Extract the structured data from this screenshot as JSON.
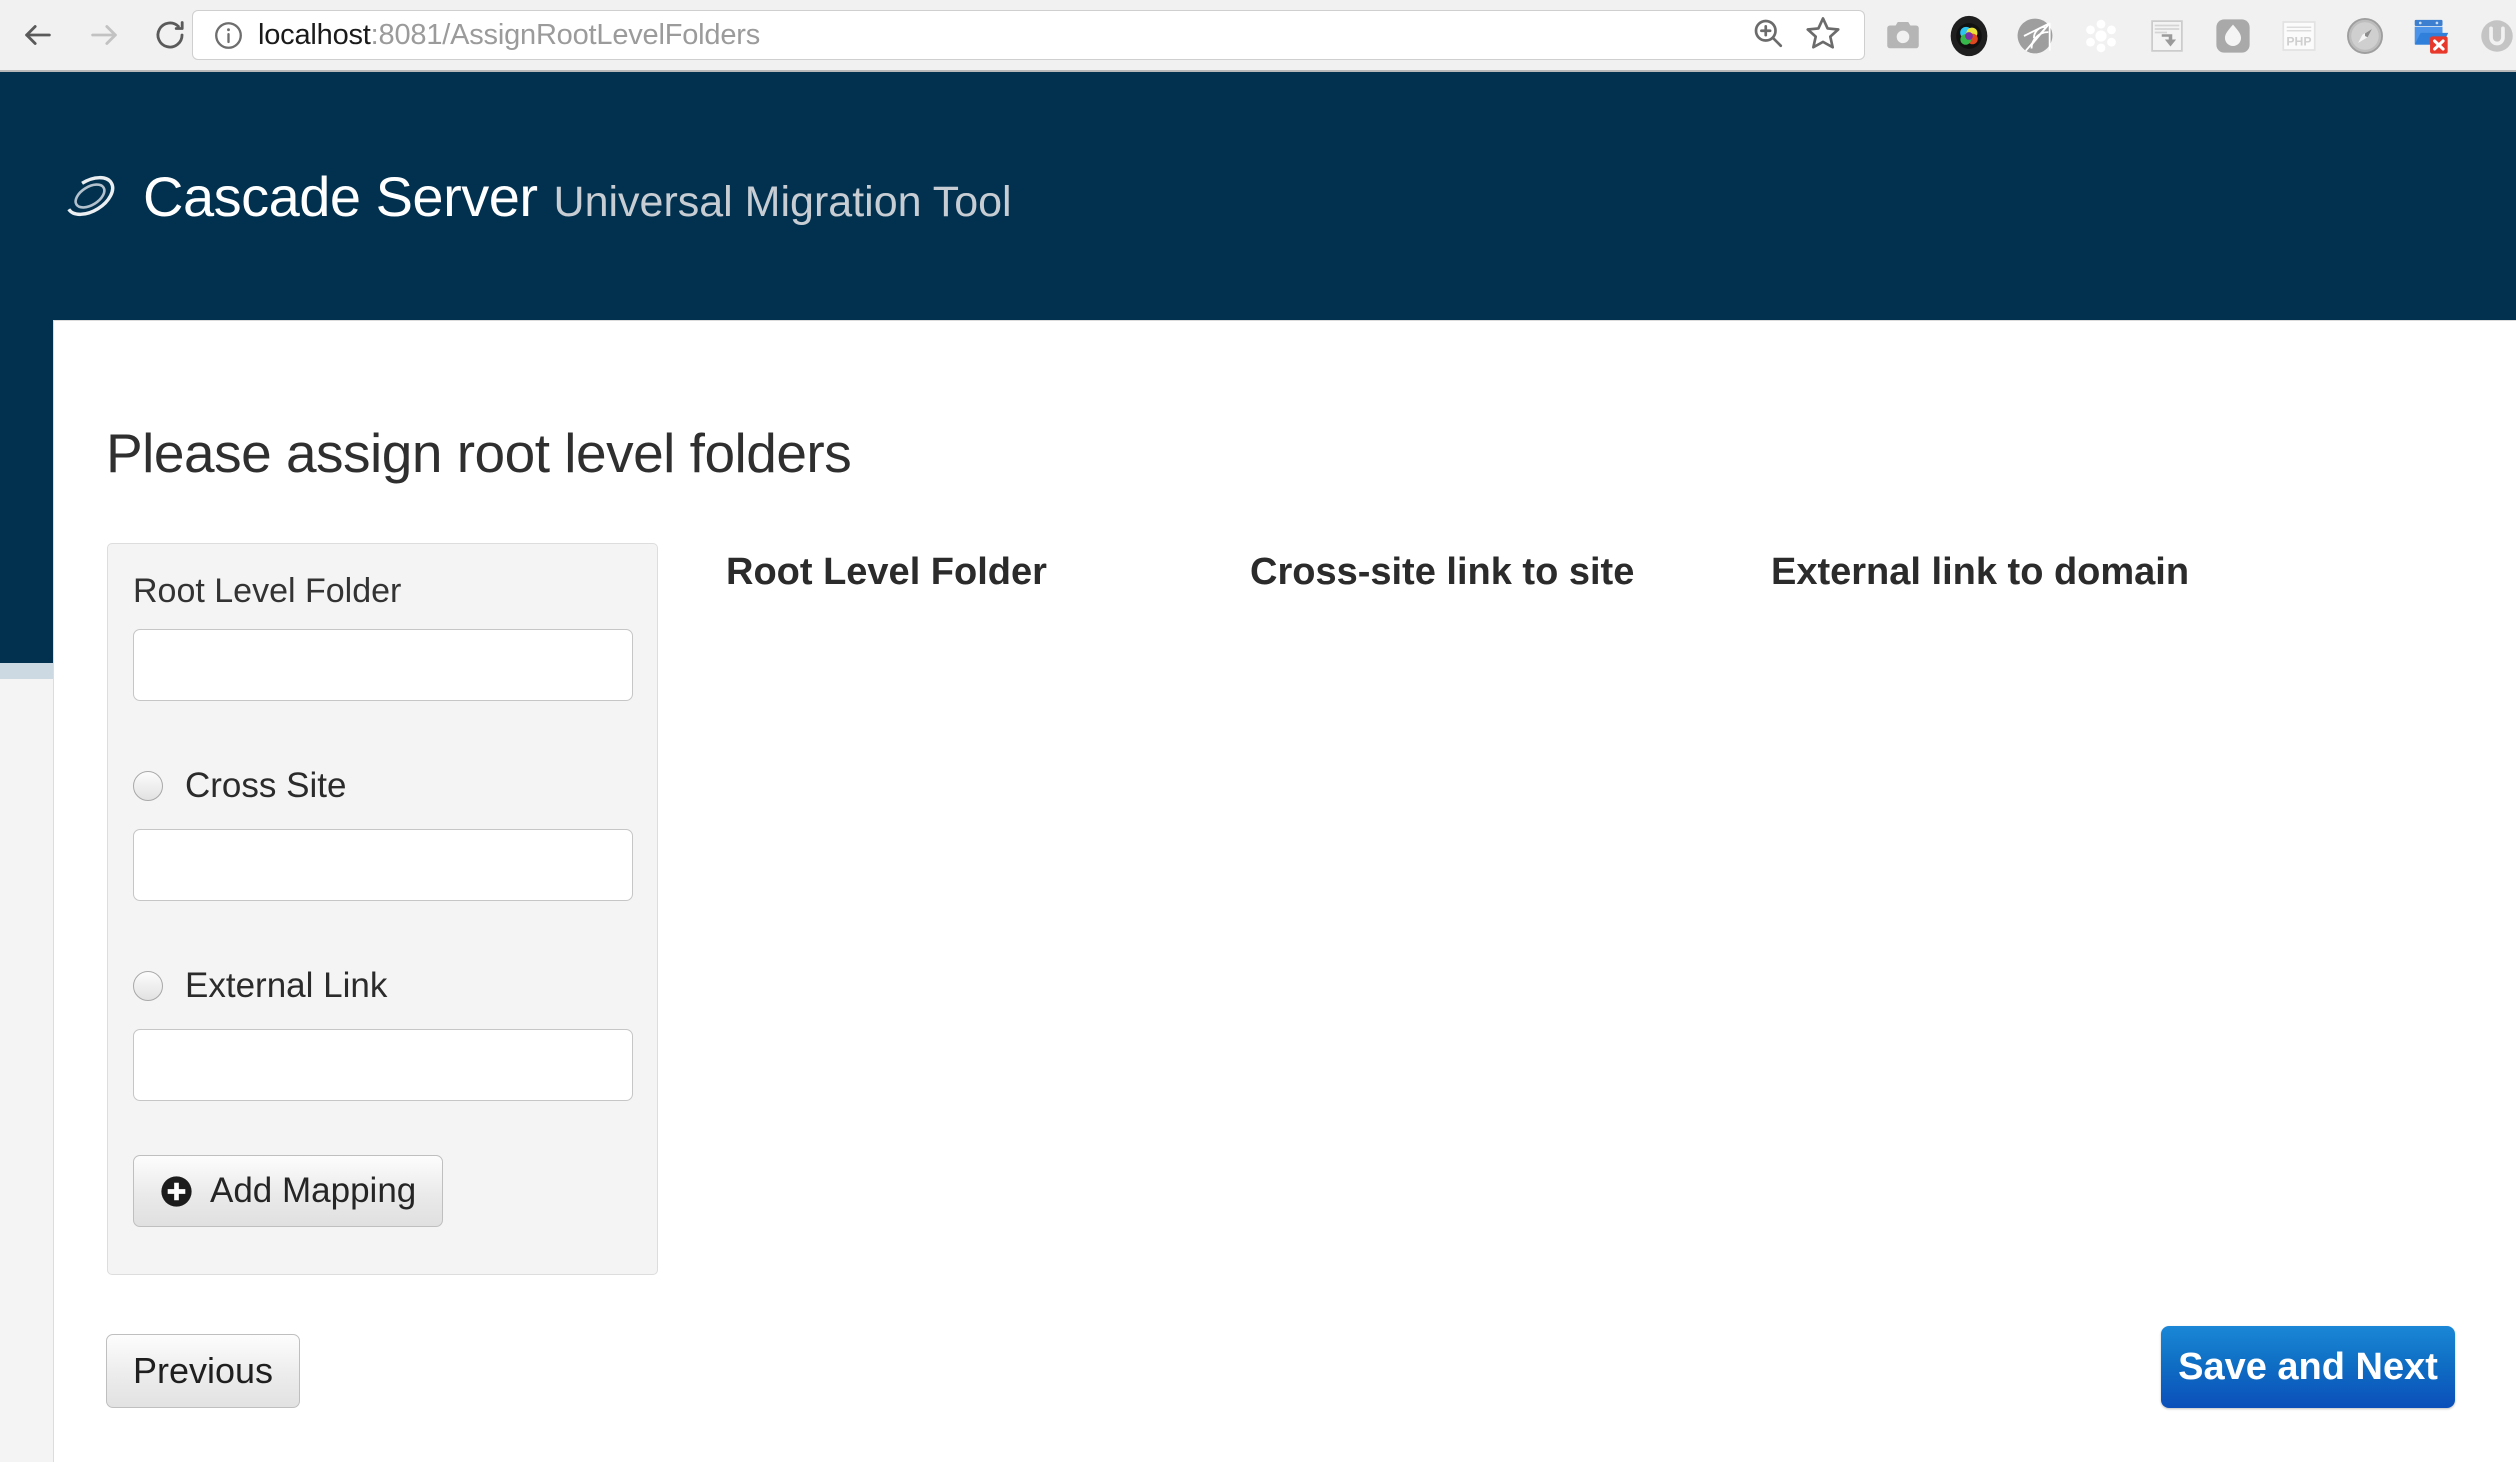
{
  "browser": {
    "back_icon": "back-arrow-icon",
    "forward_icon": "forward-arrow-icon",
    "reload_icon": "reload-icon",
    "info_icon": "info-circle-icon",
    "url_host": "localhost",
    "url_path": ":8081/AssignRootLevelFolders",
    "url_full": "localhost:8081/AssignRootLevelFolders",
    "zoom_icon": "zoom-in-icon",
    "bookmark_icon": "star-icon",
    "extensions": [
      {
        "name": "camera-icon"
      },
      {
        "name": "color-lens-icon"
      },
      {
        "name": "spider-web-icon"
      },
      {
        "name": "snowflake-icon"
      },
      {
        "name": "document-arrow-icon"
      },
      {
        "name": "ghost-droplet-icon"
      },
      {
        "name": "php-icon"
      },
      {
        "name": "compass-icon"
      },
      {
        "name": "folder-error-icon"
      },
      {
        "name": "u-circle-icon"
      },
      {
        "name": "b-box-icon"
      }
    ]
  },
  "header": {
    "logo_icon": "cascade-swirl-logo",
    "title": "Cascade Server",
    "subtitle": "Universal Migration Tool",
    "background_color": "#02314f",
    "strip_color": "#ccd9e2"
  },
  "main": {
    "page_title": "Please assign root level folders",
    "panel": {
      "root_level_folder_label": "Root Level Folder",
      "root_level_folder_value": "",
      "root_level_folder_placeholder": "",
      "cross_site_label": "Cross Site",
      "cross_site_value": "",
      "cross_site_placeholder": "",
      "cross_site_radio_icon": "radio-unselected-icon",
      "external_link_label": "External Link",
      "external_link_value": "",
      "external_link_placeholder": "",
      "external_link_radio_icon": "radio-unselected-icon",
      "add_mapping_label": "Add Mapping",
      "add_mapping_icon": "plus-circle-icon"
    },
    "columns": [
      {
        "label": "Root Level Folder"
      },
      {
        "label": "Cross-site link to site"
      },
      {
        "label": "External link to domain"
      }
    ],
    "rows": []
  },
  "footer": {
    "previous_label": "Previous",
    "save_next_label": "Save and Next",
    "save_next_color": "#0f6fc4"
  }
}
